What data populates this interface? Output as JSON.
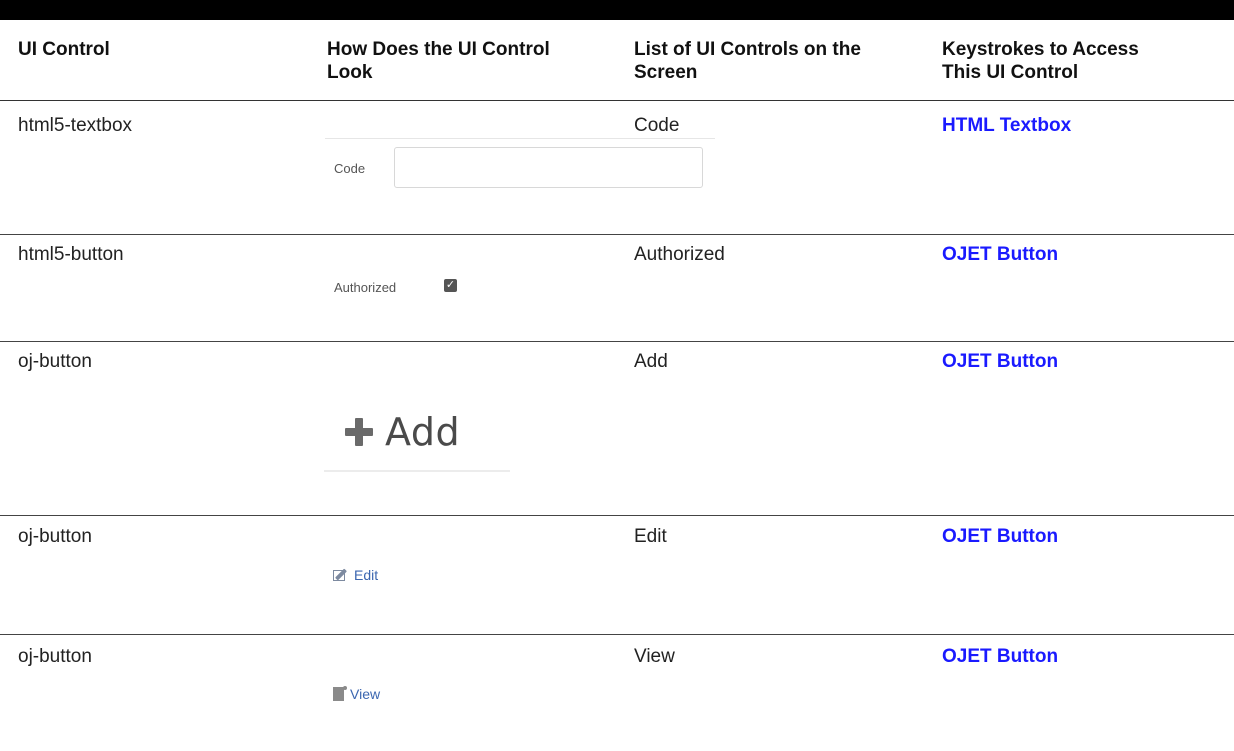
{
  "table": {
    "headers": {
      "col1": "UI Control",
      "col2_line1": "How Does the UI Control",
      "col2_line2": "Look",
      "col3_line1": "List of UI Controls on the",
      "col3_line2": "Screen",
      "col4_line1": "Keystrokes to Access",
      "col4_line2": "This UI Control"
    },
    "rows": [
      {
        "control": "html5-textbox",
        "list": "Code",
        "keystrokes": "HTML Textbox"
      },
      {
        "control": "html5-button",
        "list": "Authorized",
        "keystrokes": "OJET Button"
      },
      {
        "control": "oj-button",
        "list": "Add",
        "keystrokes": "OJET Button"
      },
      {
        "control": "oj-button",
        "list": "Edit",
        "keystrokes": "OJET Button"
      },
      {
        "control": "oj-button",
        "list": "View",
        "keystrokes": "OJET Button"
      }
    ]
  },
  "previews": {
    "textbox_label": "Code",
    "textbox_value": "",
    "checkbox_label": "Authorized",
    "checkbox_checked": true,
    "add_label": "Add",
    "edit_label": "Edit",
    "view_label": "View"
  },
  "colors": {
    "link": "#1a1aff",
    "rule": "#444444",
    "top_band": "#000000"
  },
  "icons": [
    "plus-icon",
    "edit-icon",
    "view-icon",
    "checkbox-icon"
  ]
}
